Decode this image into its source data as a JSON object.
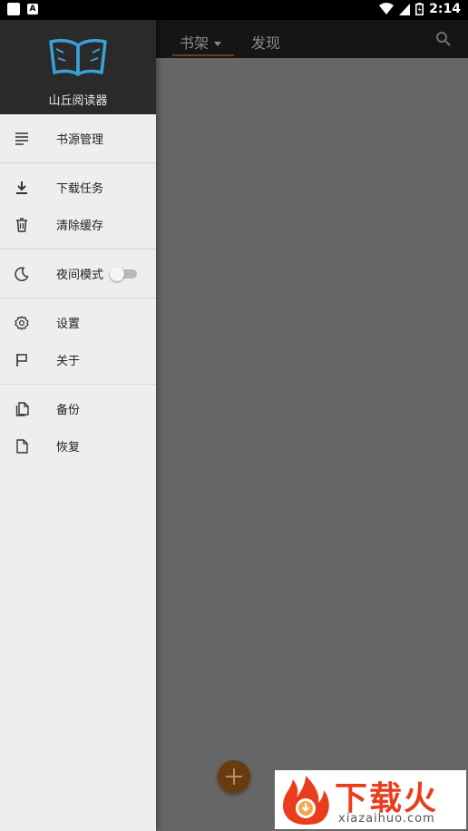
{
  "status_bar": {
    "time": "2:14"
  },
  "app": {
    "name": "山丘阅读器"
  },
  "tabs": [
    {
      "label": "书架"
    },
    {
      "label": "发现"
    }
  ],
  "drawer": {
    "groups": [
      {
        "items": [
          {
            "label": "书源管理",
            "icon": "list-icon"
          }
        ]
      },
      {
        "items": [
          {
            "label": "下载任务",
            "icon": "download-icon"
          },
          {
            "label": "清除缓存",
            "icon": "trash-icon"
          }
        ]
      },
      {
        "items": [
          {
            "label": "夜间模式",
            "icon": "moon-icon",
            "toggle": false
          }
        ]
      },
      {
        "items": [
          {
            "label": "设置",
            "icon": "gear-icon"
          },
          {
            "label": "关于",
            "icon": "flag-icon"
          }
        ]
      },
      {
        "items": [
          {
            "label": "备份",
            "icon": "copy-file-icon"
          },
          {
            "label": "恢复",
            "icon": "file-icon"
          }
        ]
      }
    ]
  },
  "watermark": {
    "title": "下载火",
    "url": "xiazaihuo.com"
  },
  "colors": {
    "accent": "#3aa0d8",
    "drawer_header": "#2a2a2a",
    "appbar": "#151515",
    "fab": "#6a3a10",
    "watermark_red": "#ea3d1e"
  }
}
